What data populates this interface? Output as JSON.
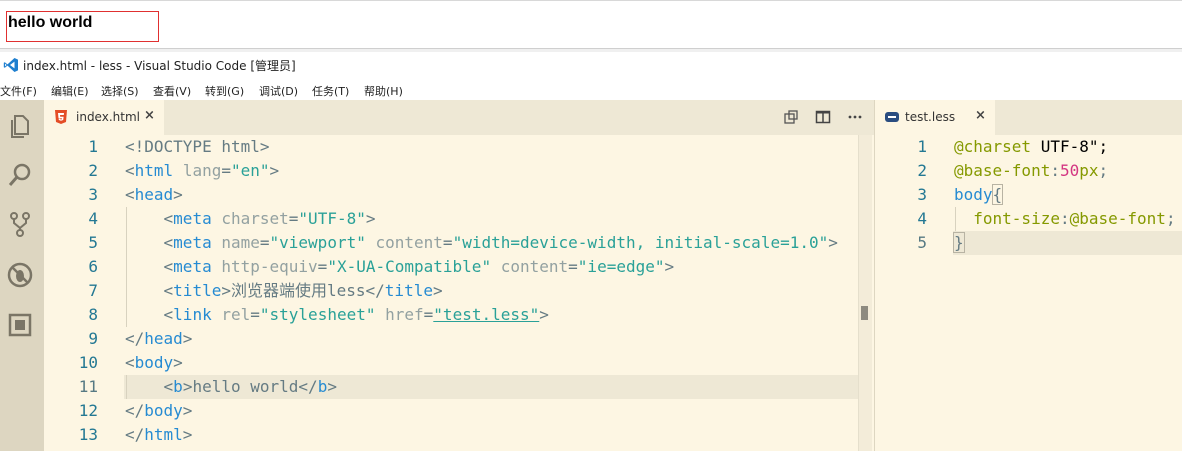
{
  "preview": {
    "text": "hello world"
  },
  "window": {
    "title": "index.html - less - Visual Studio Code [管理员]"
  },
  "menu": [
    {
      "label": "文件(F)"
    },
    {
      "label": "编辑(E)"
    },
    {
      "label": "选择(S)"
    },
    {
      "label": "查看(V)"
    },
    {
      "label": "转到(G)"
    },
    {
      "label": "调试(D)"
    },
    {
      "label": "任务(T)"
    },
    {
      "label": "帮助(H)"
    }
  ],
  "activity_bar": [
    "files-icon",
    "search-icon",
    "source-control-icon",
    "debug-icon",
    "extensions-icon"
  ],
  "editor_left": {
    "tab": {
      "label": "index.html",
      "close": "×",
      "icon": "html5-icon"
    },
    "line_numbers": [
      "1",
      "2",
      "3",
      "4",
      "5",
      "6",
      "7",
      "8",
      "9",
      "10",
      "11",
      "12",
      "13"
    ],
    "lines": [
      "<!DOCTYPE html>",
      "<html lang=\"en\">",
      "<head>",
      "    <meta charset=\"UTF-8\">",
      "    <meta name=\"viewport\" content=\"width=device-width, initial-scale=1.0\">",
      "    <meta http-equiv=\"X-UA-Compatible\" content=\"ie=edge\">",
      "    <title>浏览器端使用less</title>",
      "    <link rel=\"stylesheet\" href=\"test.less\">",
      "</head>",
      "<body>",
      "    <b>hello world</b>",
      "</body>",
      "</html>"
    ],
    "active_line": "11"
  },
  "editor_right": {
    "tab": {
      "label": "test.less",
      "close": "×",
      "icon": "less-icon"
    },
    "line_numbers": [
      "1",
      "2",
      "3",
      "4",
      "5"
    ],
    "lines": [
      "@charset \"UTF-8\";",
      "@base-font:50px;",
      "body{",
      "  font-size:@base-font;",
      "}"
    ],
    "active_line": "5"
  },
  "colors": {
    "background": "#fdf6e3",
    "tabbar": "#eee8d5",
    "activitybar": "#ddd6c1",
    "tag": "#268bd2",
    "string": "#2aa198",
    "attribute": "#93a1a1",
    "keyword": "#859900",
    "number": "#d33682",
    "line_number": "#237893"
  }
}
